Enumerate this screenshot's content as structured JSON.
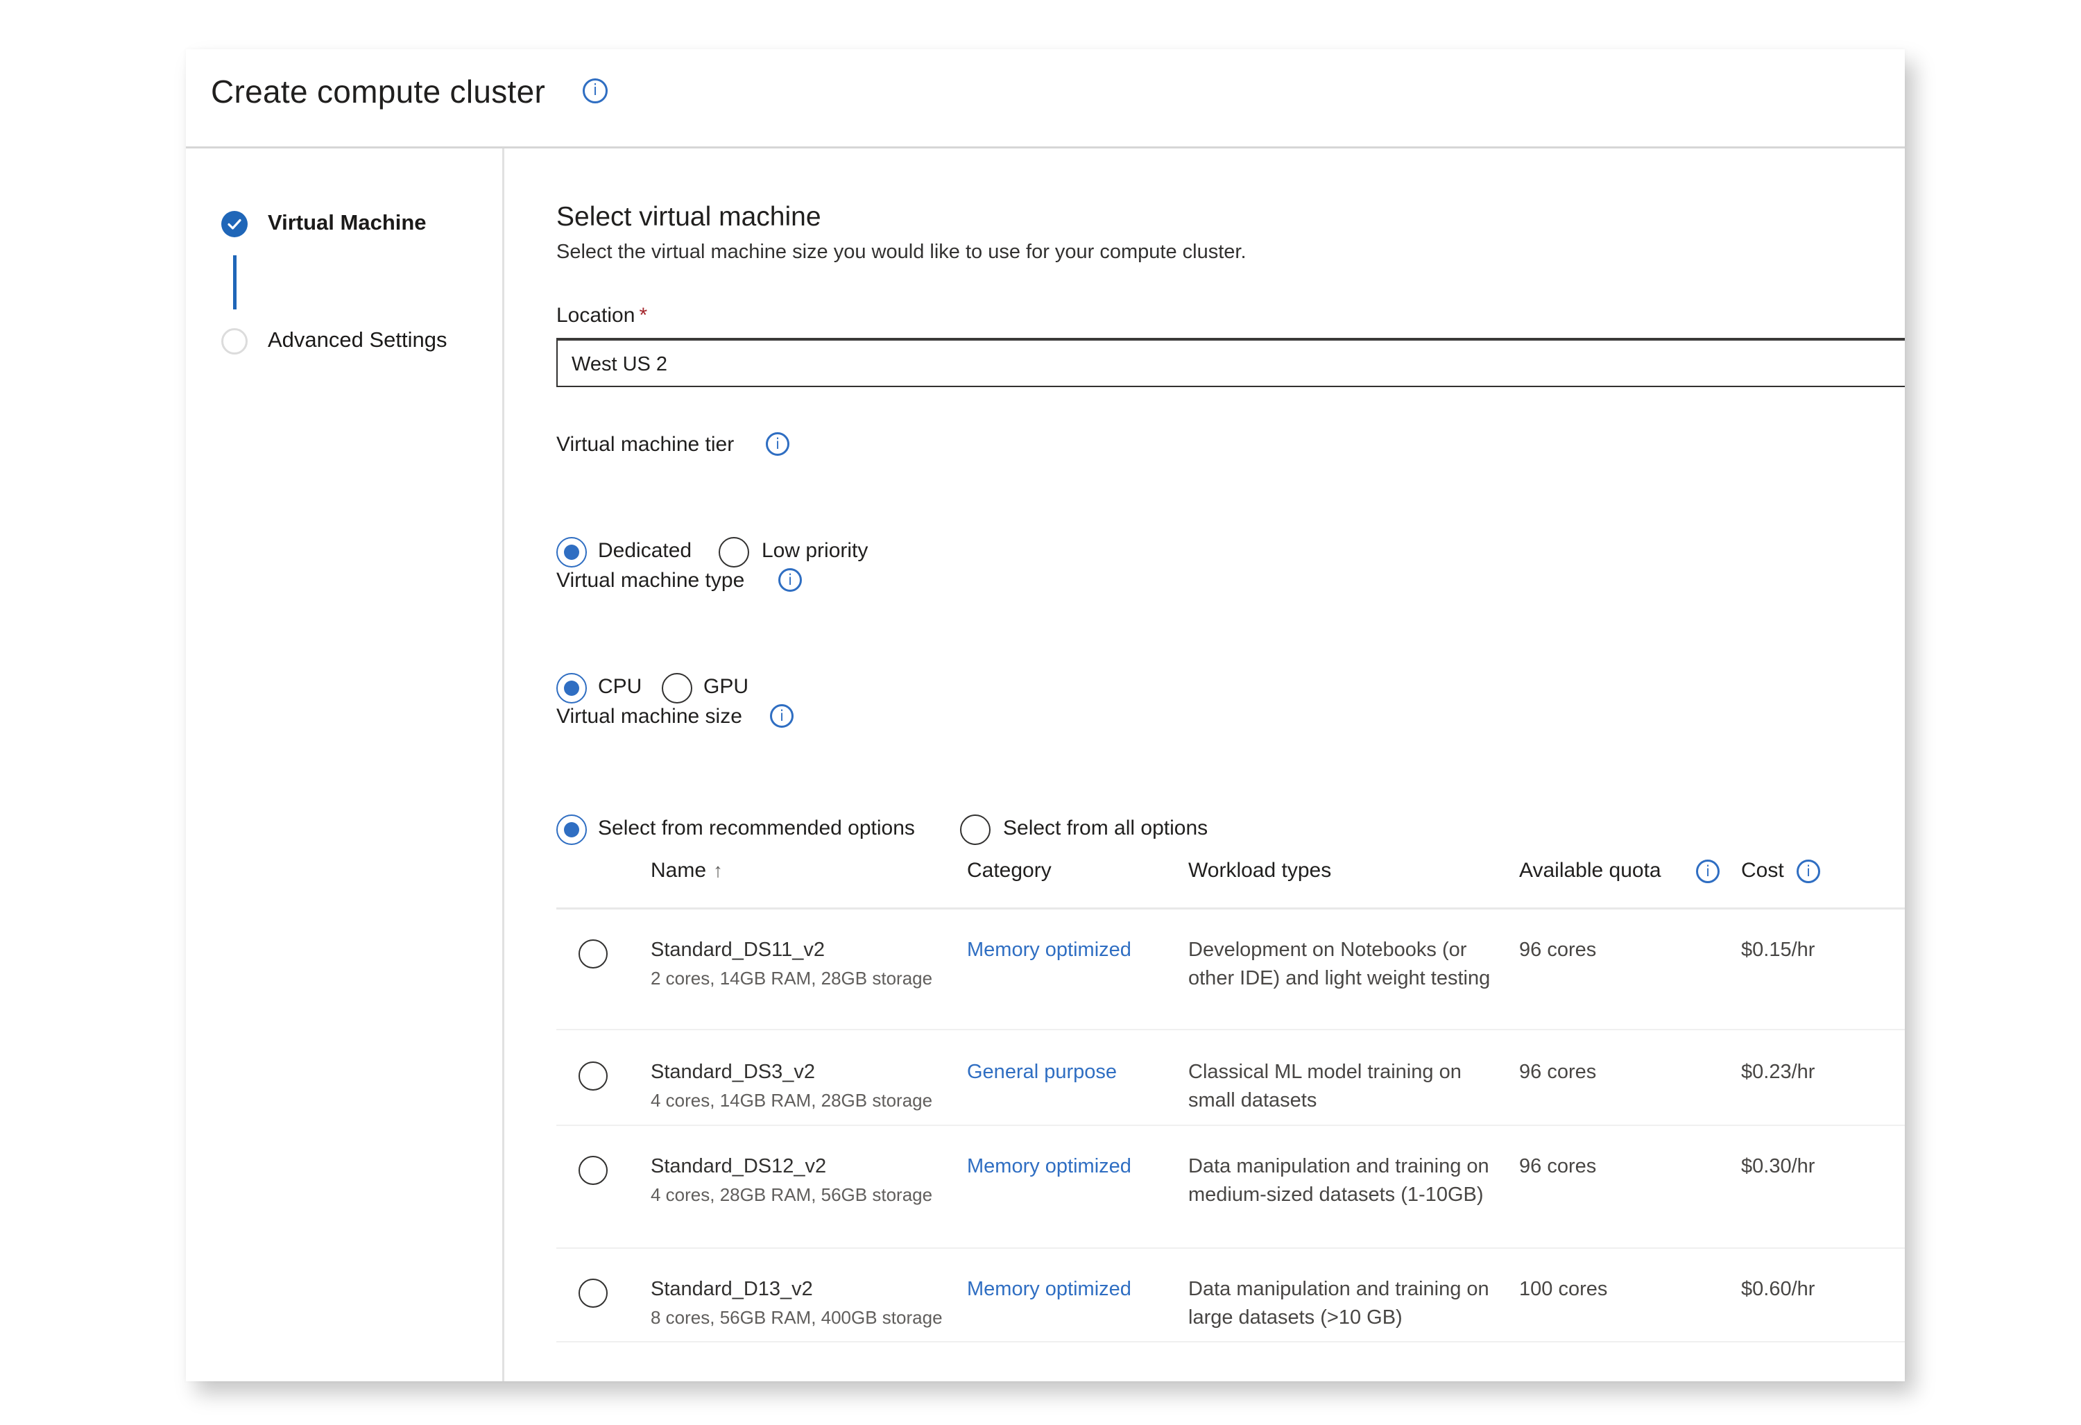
{
  "header": {
    "title": "Create compute cluster",
    "info_icon": "info-icon"
  },
  "stepper": {
    "steps": [
      {
        "label": "Virtual Machine",
        "state": "completed",
        "icon": "check-circle-icon"
      },
      {
        "label": "Advanced Settings",
        "state": "pending",
        "icon": "empty-circle-icon"
      }
    ]
  },
  "main": {
    "heading": "Select virtual machine",
    "subtitle": "Select the virtual machine size you would like to use for your compute cluster.",
    "location": {
      "label": "Location",
      "required_mark": "*",
      "value": "West US 2"
    },
    "tier": {
      "label": "Virtual machine tier",
      "options": [
        {
          "label": "Dedicated",
          "checked": true
        },
        {
          "label": "Low priority",
          "checked": false
        }
      ]
    },
    "type": {
      "label": "Virtual machine type",
      "options": [
        {
          "label": "CPU",
          "checked": true
        },
        {
          "label": "GPU",
          "checked": false
        }
      ]
    },
    "size": {
      "label": "Virtual machine size",
      "options": [
        {
          "label": "Select from recommended options",
          "checked": true
        },
        {
          "label": "Select from all options",
          "checked": false
        }
      ]
    },
    "table": {
      "columns": {
        "name": "Name",
        "name_sort": "↑",
        "category": "Category",
        "workload": "Workload types",
        "quota": "Available quota",
        "cost": "Cost"
      },
      "rows": [
        {
          "name": "Standard_DS11_v2",
          "spec": "2 cores, 14GB RAM, 28GB storage",
          "category": "Memory optimized",
          "workload": "Development on Notebooks (or other IDE) and light weight testing",
          "quota": "96 cores",
          "cost": "$0.15/hr",
          "selected": false
        },
        {
          "name": "Standard_DS3_v2",
          "spec": "4 cores, 14GB RAM, 28GB storage",
          "category": "General purpose",
          "workload": "Classical ML model training on small datasets",
          "quota": "96 cores",
          "cost": "$0.23/hr",
          "selected": false
        },
        {
          "name": "Standard_DS12_v2",
          "spec": "4 cores, 28GB RAM, 56GB storage",
          "category": "Memory optimized",
          "workload": "Data manipulation and training on medium-sized datasets (1-10GB)",
          "quota": "96 cores",
          "cost": "$0.30/hr",
          "selected": false
        },
        {
          "name": "Standard_D13_v2",
          "spec": "8 cores, 56GB RAM, 400GB storage",
          "category": "Memory optimized",
          "workload": "Data manipulation and training on large datasets (>10 GB)",
          "quota": "100 cores",
          "cost": "$0.60/hr",
          "selected": false
        }
      ]
    }
  },
  "colors": {
    "accent": "#2f6ec2",
    "step_active": "#1f66b8",
    "required": "#a4262c"
  }
}
